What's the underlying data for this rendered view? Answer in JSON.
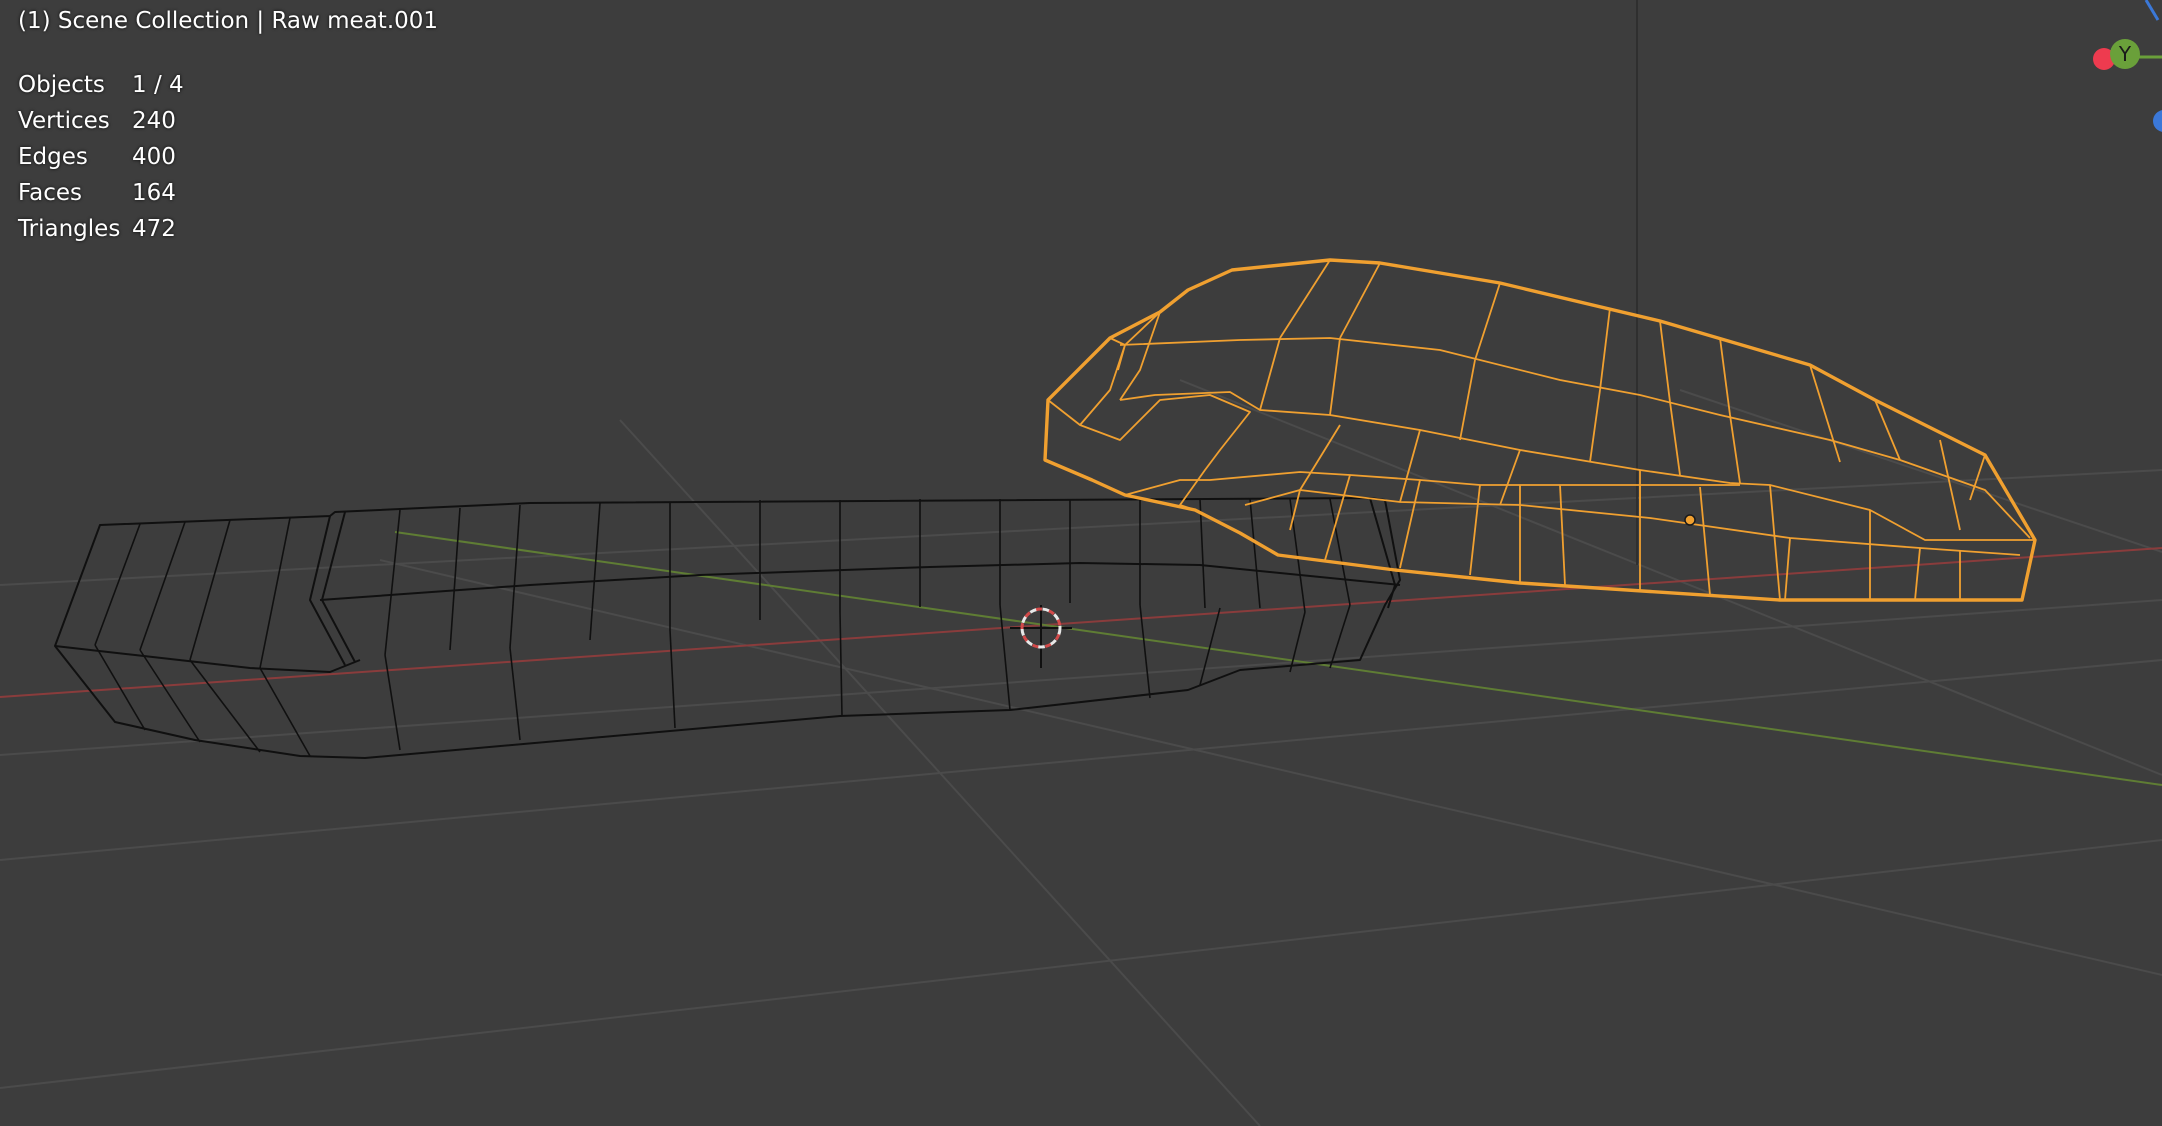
{
  "viewport": {
    "header_text": "(1) Scene Collection | Raw meat.001",
    "stats": [
      {
        "label": "Objects",
        "value": "1 / 4"
      },
      {
        "label": "Vertices",
        "value": "240"
      },
      {
        "label": "Edges",
        "value": "400"
      },
      {
        "label": "Faces",
        "value": "164"
      },
      {
        "label": "Triangles",
        "value": "472"
      }
    ]
  },
  "gizmo": {
    "y_label": "Y",
    "colors": {
      "x": "#ee3b4f",
      "y": "#6aa03a",
      "z": "#3b78d8"
    }
  },
  "theme": {
    "background": "#3d3d3d",
    "grid": "#4b4b4b",
    "x_axis": "#8a3c3c",
    "y_axis": "#5f7d34",
    "selected_wire": "#f0a030",
    "unselected_wire": "#101010",
    "cursor_ring_a": "#e8e8e8",
    "cursor_ring_b": "#d24a4a"
  }
}
